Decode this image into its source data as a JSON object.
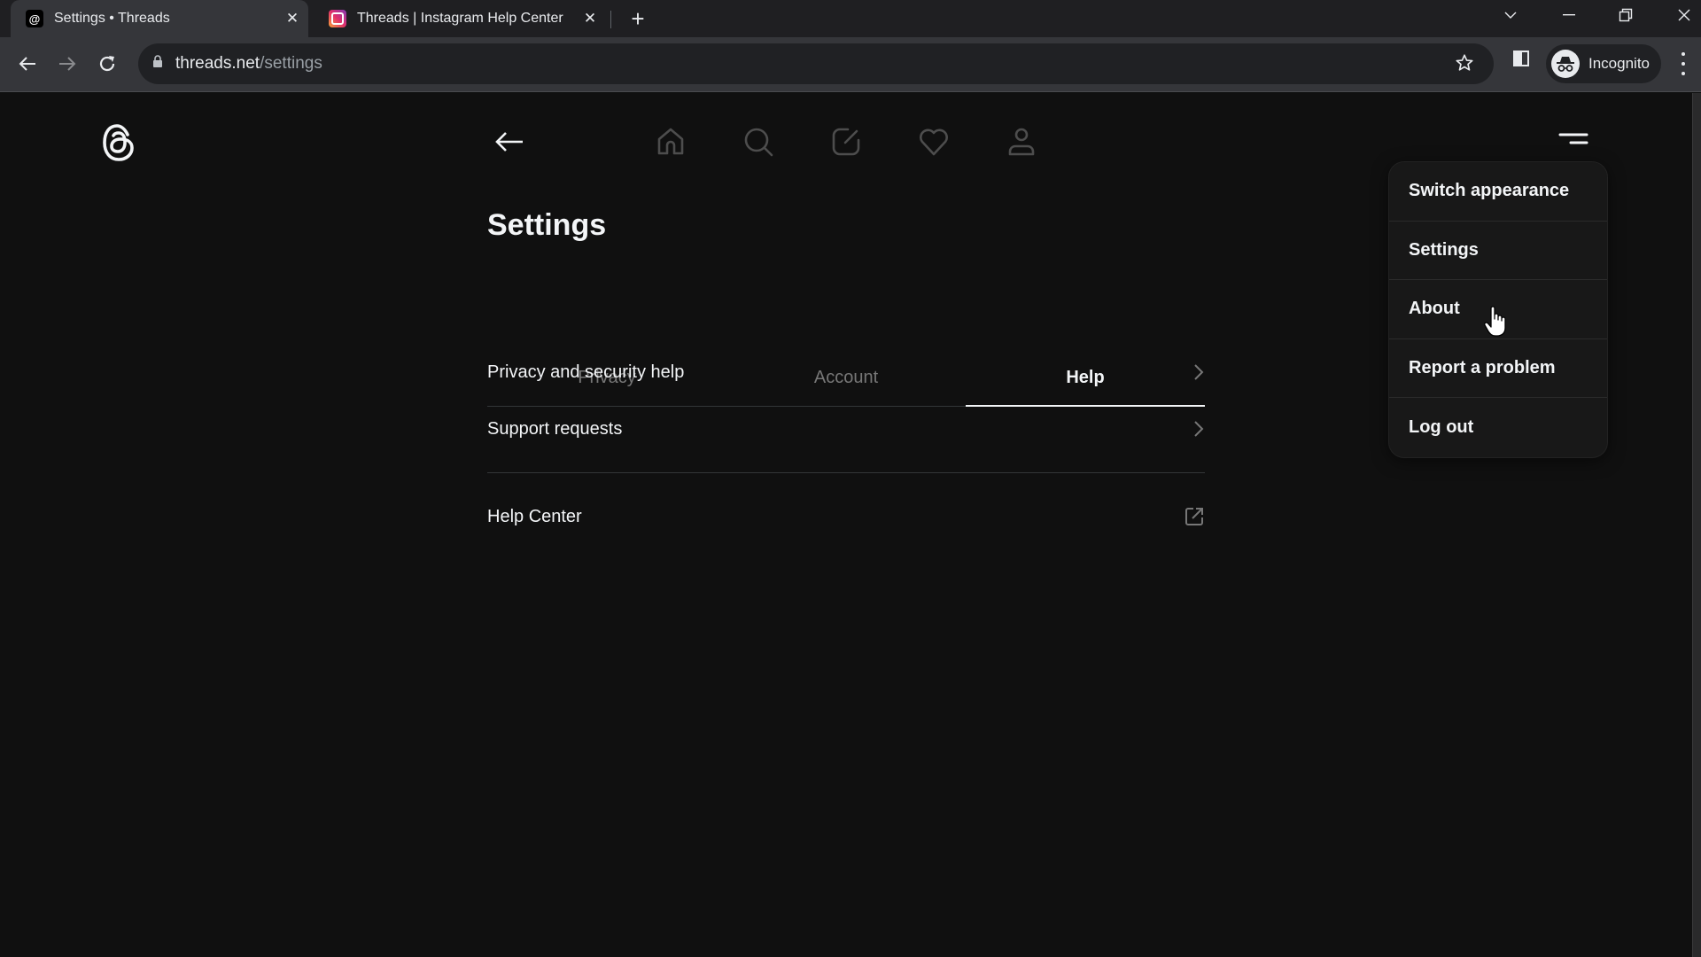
{
  "browser": {
    "tabs": [
      {
        "title": "Settings • Threads",
        "favicon": "threads-logo-icon",
        "active": true,
        "close_label": "✕"
      },
      {
        "title": "Threads | Instagram Help Center",
        "favicon": "instagram-icon",
        "active": false,
        "close_label": "✕"
      }
    ],
    "new_tab_label": "+",
    "window_controls": {
      "tab_search": "⌄",
      "minimize": "—",
      "restore": "❐",
      "close": "✕"
    },
    "address": {
      "host": "threads.net",
      "path": "/settings"
    },
    "profile_label": "Incognito"
  },
  "page": {
    "title": "Settings",
    "tabs": [
      {
        "label": "Privacy",
        "active": false
      },
      {
        "label": "Account",
        "active": false
      },
      {
        "label": "Help",
        "active": true
      }
    ],
    "help_items": [
      {
        "label": "Privacy and security help",
        "icon": "chevron-right-icon"
      },
      {
        "label": "Support requests",
        "icon": "chevron-right-icon"
      }
    ],
    "external_items": [
      {
        "label": "Help Center",
        "icon": "external-link-icon"
      }
    ]
  },
  "menu": {
    "items": [
      {
        "label": "Switch appearance"
      },
      {
        "label": "Settings"
      },
      {
        "label": "About",
        "hovered": true
      },
      {
        "label": "Report a problem"
      },
      {
        "label": "Log out"
      }
    ]
  },
  "colors": {
    "background": "#101010",
    "text_primary": "#f3f5f7",
    "text_muted": "#777777",
    "icon_inactive": "#4d4d4d",
    "menu_bg": "#181818"
  }
}
